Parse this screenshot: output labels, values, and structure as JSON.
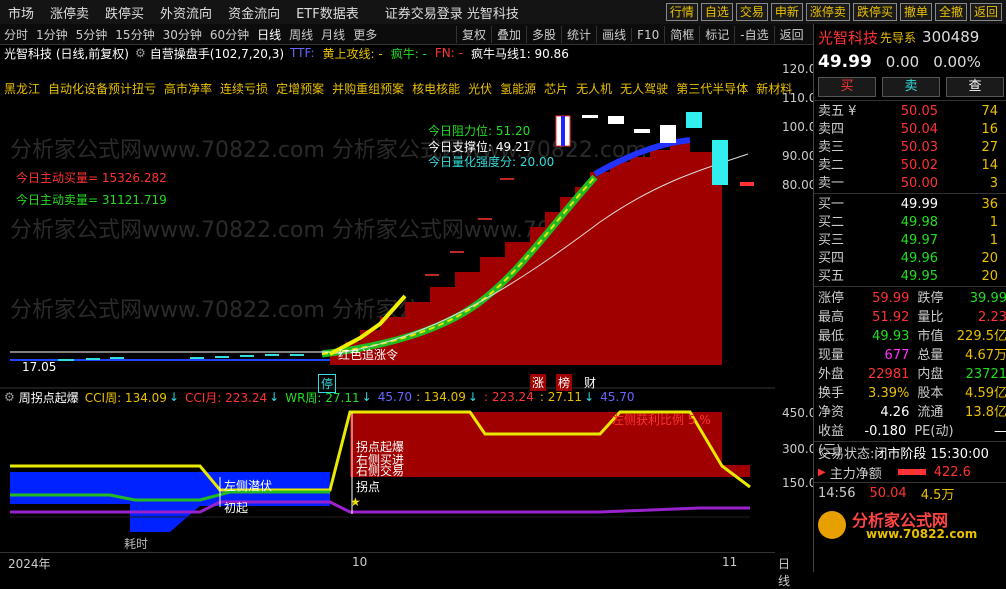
{
  "top_menu": [
    "市场",
    "涨停卖",
    "跌停买",
    "外资流向",
    "资金流向",
    "ETF数据表"
  ],
  "top_alert": "证券交易登录  光智科技",
  "top_buttons": [
    {
      "label": "行情",
      "style": "normal"
    },
    {
      "label": "自选",
      "style": "normal"
    },
    {
      "label": "交易",
      "style": "normal"
    },
    {
      "label": "申新",
      "style": "normal"
    },
    {
      "label": "涨停卖",
      "style": "normal"
    },
    {
      "label": "跌停买",
      "style": "normal"
    },
    {
      "label": "撤单",
      "style": "normal"
    },
    {
      "label": "全撤",
      "style": "normal"
    },
    {
      "label": "返回",
      "style": "normal"
    }
  ],
  "periods": [
    "分时",
    "1分钟",
    "5分钟",
    "15分钟",
    "30分钟",
    "60分钟",
    "日线",
    "周线",
    "月线",
    "更多"
  ],
  "active_period": "日线",
  "toolbar_right": [
    "复权",
    "叠加",
    "多股",
    "统计",
    "画线",
    "F10",
    "简框",
    "标记",
    "-自选",
    "返回"
  ],
  "infobar": {
    "stock": "光智科技 (日线,前复权)",
    "indicator": "自营操盘手(102,7,20,3)",
    "ttf": "TTF:",
    "line1": "黄上攻线: -",
    "line2": "疯牛: -",
    "fn": "FN: -",
    "madline": "疯牛马线1: 90.86"
  },
  "concepts": [
    "黑龙江",
    "自动化设备预计扭亏",
    "高市净率",
    "连续亏损",
    "定增预案",
    "并购重组预案",
    "核电核能",
    "光伏",
    "氢能源",
    "芯片",
    "无人机",
    "无人驾驶",
    "第三代半导体",
    "新材料"
  ],
  "chart_annotations": {
    "buy_vol": "今日主动买量= 15326.282",
    "sell_vol": "今日主动卖量= 31121.719",
    "resistance": "今日阻力位: 51.20",
    "support": "今日支撑位: 49.21",
    "strength": "今日量化强度分: 20.00",
    "low_price": "17.05",
    "signal_text": "红色追涨令",
    "marker_zt": "停",
    "marker_zhang": "涨",
    "marker_bang": "榜",
    "marker_cai": "财"
  },
  "lower_bar": {
    "name": "周拐点起爆",
    "cci_week": "CCI周: 134.09",
    "cci_month": "CCI月: 223.24",
    "wr_week": "WR周: 27.11",
    "v1": "45.70",
    "v2": ": 134.09",
    "v3": ": 223.24",
    "v4": ": 27.11",
    "v5": "45.70"
  },
  "lower_annotations": {
    "left_profit": "左侧获利比例 5 %",
    "inflect_boom": "拐点起爆",
    "right_buy": "右侧买进",
    "right_trade": "右侧交易",
    "left_latent": "左侧潜伏",
    "start": "初起",
    "inflect": "拐点",
    "time_cost": "耗时"
  },
  "y_axis_main": [
    "120.00",
    "110.00",
    "100.00",
    "90.00",
    "80.00"
  ],
  "y_axis_lower": [
    "450.0",
    "300.0",
    "150.0"
  ],
  "dates": [
    "2024年",
    "10",
    "11"
  ],
  "right_date_label": "日线",
  "quote": {
    "name": "光智科技",
    "flag": "先导系",
    "code": "300489",
    "price": "49.99",
    "change": "0.00",
    "pct": "0.00%",
    "buy_btn": "买",
    "sell_btn": "卖",
    "query_btn": "查",
    "asks": [
      {
        "label": "卖五 ¥",
        "price": "50.05",
        "vol": "74"
      },
      {
        "label": "卖四",
        "price": "50.04",
        "vol": "16"
      },
      {
        "label": "卖三",
        "price": "50.03",
        "vol": "27"
      },
      {
        "label": "卖二",
        "price": "50.02",
        "vol": "14"
      },
      {
        "label": "卖一",
        "price": "50.00",
        "vol": "3"
      }
    ],
    "bids": [
      {
        "label": "买一",
        "price": "49.99",
        "vol": "36"
      },
      {
        "label": "买二",
        "price": "49.98",
        "vol": "1"
      },
      {
        "label": "买三",
        "price": "49.97",
        "vol": "1"
      },
      {
        "label": "买四",
        "price": "49.96",
        "vol": "20"
      },
      {
        "label": "买五",
        "price": "49.95",
        "vol": "20"
      }
    ],
    "stats": [
      {
        "l": "涨停",
        "v": "59.99",
        "vc": "red",
        "l2": "跌停",
        "v2": "39.99",
        "v2c": "green"
      },
      {
        "l": "最高",
        "v": "51.92",
        "vc": "red",
        "l2": "量比",
        "v2": "2.23",
        "v2c": "red"
      },
      {
        "l": "最低",
        "v": "49.93",
        "vc": "green",
        "l2": "市值",
        "v2": "229.5亿",
        "v2c": "yellow"
      },
      {
        "l": "现量",
        "v": "677",
        "vc": "magenta",
        "l2": "总量",
        "v2": "4.67万",
        "v2c": "yellow"
      },
      {
        "l": "外盘",
        "v": "22981",
        "vc": "red",
        "l2": "内盘",
        "v2": "23721",
        "v2c": "green"
      },
      {
        "l": "换手",
        "v": "3.39%",
        "vc": "yellow",
        "l2": "股本",
        "v2": "4.59亿",
        "v2c": "yellow"
      },
      {
        "l": "净资",
        "v": "4.26",
        "vc": "white",
        "l2": "流通",
        "v2": "13.8亿",
        "v2c": "yellow"
      },
      {
        "l": "收益(三)",
        "v": "-0.180",
        "vc": "white",
        "l2": "PE(动)",
        "v2": "—",
        "v2c": "white"
      }
    ],
    "trade_state_label": "交易状态:",
    "trade_state": "闭市阶段 15:30:00",
    "main_flow_label": "主力净额",
    "main_flow": "422.6",
    "last_tick": {
      "time": "14:56",
      "price": "50.04",
      "vol": "4.5万"
    },
    "brand": "分析家公式网",
    "brand_url": "www.70822.com"
  }
}
